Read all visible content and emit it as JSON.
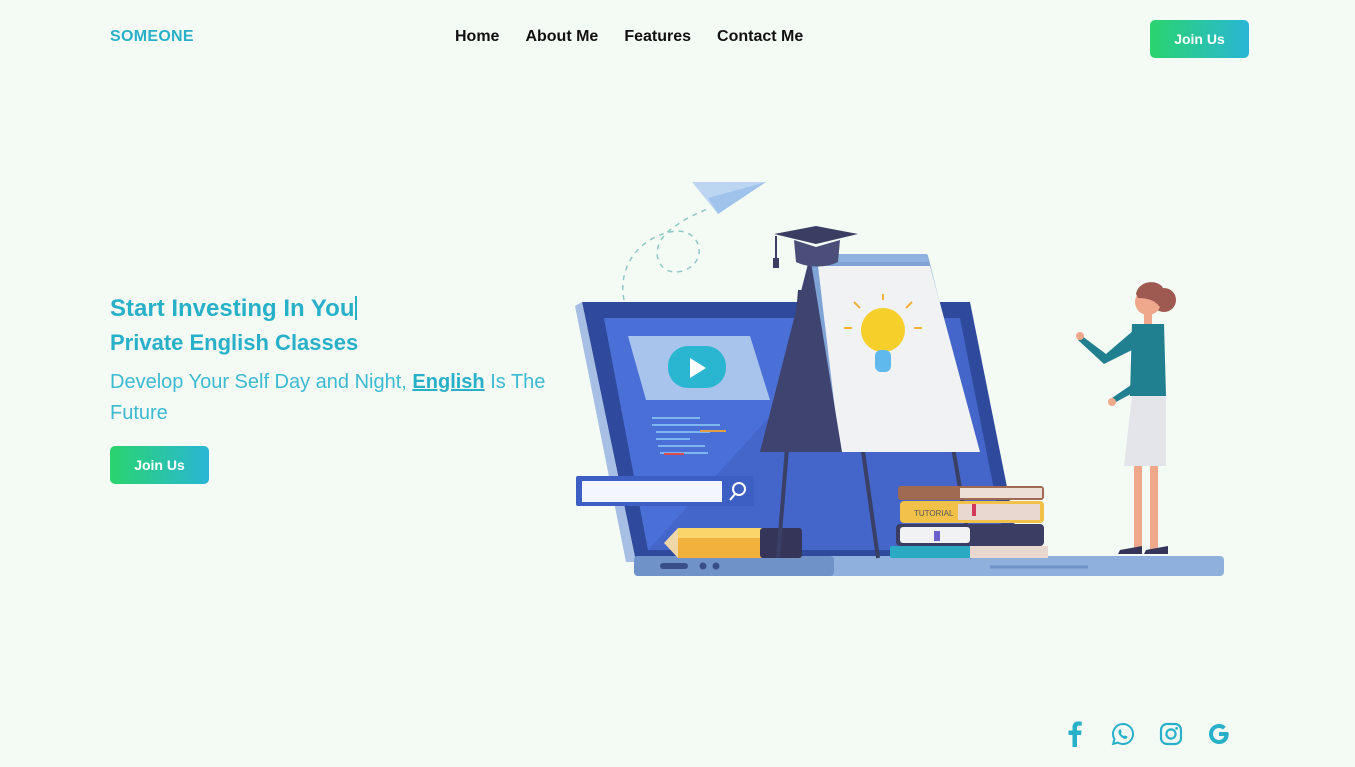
{
  "brand": "SOMEONE",
  "nav": {
    "items": [
      {
        "label": "Home"
      },
      {
        "label": "About Me"
      },
      {
        "label": "Features"
      },
      {
        "label": "Contact Me"
      }
    ],
    "join_label": "Join Us"
  },
  "hero": {
    "title": "Start Investing In You",
    "subtitle": "Private English Classes",
    "desc_before": "Develop Your Self Day and Night, ",
    "desc_highlight": "English",
    "desc_after": " Is The Future",
    "join_label": "Join Us"
  },
  "illustration": {
    "search_icon": "search-icon",
    "play_icon": "play-icon",
    "book_label": "TUTORIAL"
  },
  "socials": [
    "facebook-icon",
    "whatsapp-icon",
    "instagram-icon",
    "google-icon"
  ],
  "colors": {
    "accent": "#29b0c9",
    "background": "#f4fbf4",
    "gradient_start": "#2bd46e",
    "gradient_end": "#29b6d6"
  }
}
